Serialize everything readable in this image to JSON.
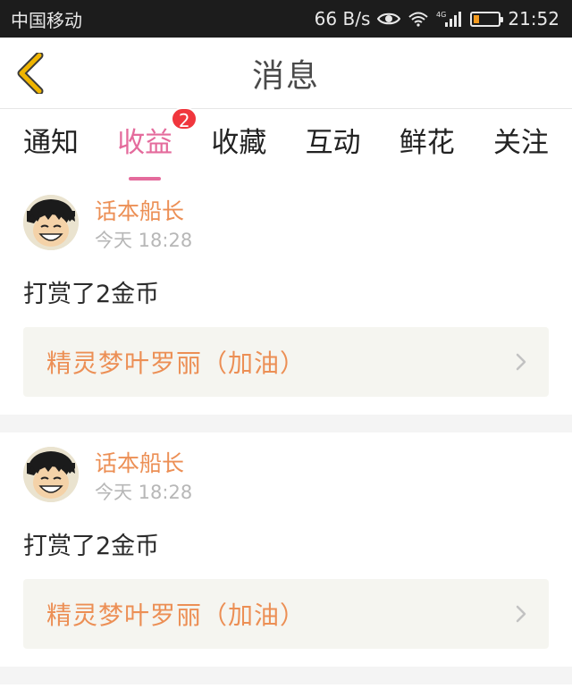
{
  "status_bar": {
    "carrier": "中国移动",
    "net_speed": "66 B/s",
    "network_type": "4G",
    "time": "21:52",
    "battery_percent": 20,
    "icons": [
      "eye-icon",
      "wifi-icon",
      "signal-icon",
      "battery-icon"
    ]
  },
  "header": {
    "title": "消息",
    "back_icon": "chevron-left-icon"
  },
  "tabs": [
    {
      "label": "通知",
      "active": false
    },
    {
      "label": "收益",
      "active": true,
      "badge": "2"
    },
    {
      "label": "收藏",
      "active": false
    },
    {
      "label": "互动",
      "active": false
    },
    {
      "label": "鲜花",
      "active": false
    },
    {
      "label": "关注",
      "active": false
    }
  ],
  "messages": [
    {
      "user": "话本船长",
      "time": "今天 18:28",
      "text": "打赏了2金币",
      "link": "精灵梦叶罗丽（加油）"
    },
    {
      "user": "话本船长",
      "time": "今天 18:28",
      "text": "打赏了2金币",
      "link": "精灵梦叶罗丽（加油）"
    }
  ],
  "colors": {
    "accent_pink": "#e46b9c",
    "name_orange": "#ec8f55",
    "badge_red": "#f0363d",
    "back_arrow_gold": "#f0b500"
  }
}
